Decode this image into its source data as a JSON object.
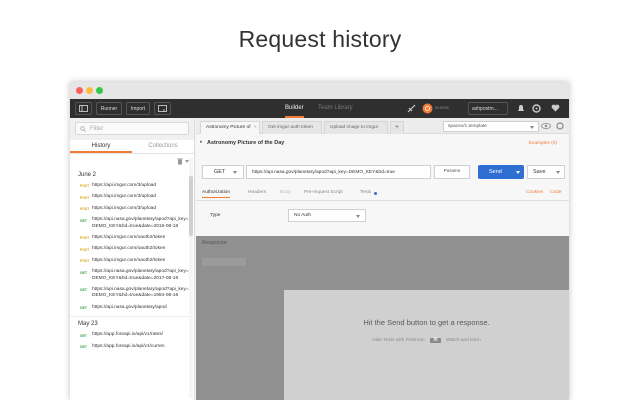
{
  "page": {
    "heading": "Request history"
  },
  "colors": {
    "accent": "#f27b35",
    "send_button": "#2f6fd4",
    "toolbar_bg": "#2f2f2f",
    "get_method": "#3a9e45",
    "post_method": "#d8a21e"
  },
  "toolbar": {
    "runner_label": "Runner",
    "import_label": "Import",
    "builder_tab": "Builder",
    "team_library_tab": "Team Library",
    "status_label": "IN SYNC",
    "workspace_label": "ashpostm...",
    "icons": [
      "sidebar-toggle-icon",
      "new-window-icon",
      "satellite-icon",
      "sync-icon",
      "bell-icon",
      "settings-icon",
      "heart-icon"
    ]
  },
  "sidebar": {
    "filter_placeholder": "Filter",
    "tabs": [
      "History",
      "Collections"
    ],
    "groups": [
      {
        "date": "June 2",
        "items": [
          {
            "method": "POST",
            "url": "https://api.imgur.com/3/upload"
          },
          {
            "method": "POST",
            "url": "https://api.imgur.com/3/upload"
          },
          {
            "method": "POST",
            "url": "https://api.imgur.com/3/upload"
          },
          {
            "method": "GET",
            "url": "https://api.nasa.gov/planetary/apod?api_key=DEMO_KEY&hd=true&date=2016-08-18"
          },
          {
            "method": "POST",
            "url": "https://api.imgur.com/oauth2/token"
          },
          {
            "method": "POST",
            "url": "https://api.imgur.com/oauth2/token"
          },
          {
            "method": "POST",
            "url": "https://api.imgur.com/oauth2/token"
          },
          {
            "method": "GET",
            "url": "https://api.nasa.gov/planetary/apod?api_key=DEMO_KEY&hd=true&date=2017-08-18"
          },
          {
            "method": "GET",
            "url": "https://api.nasa.gov/planetary/apod?api_key=DEMO_KEY&hd=true&date=1984-08-18"
          },
          {
            "method": "GET",
            "url": "https://api.nasa.gov/planetary/apod"
          }
        ]
      },
      {
        "date": "May 23",
        "items": [
          {
            "method": "GET",
            "url": "https://app.foreapi.io/api/v1/rates/"
          },
          {
            "method": "GET",
            "url": "https://app.foreapi.io/api/v1/curren"
          }
        ]
      }
    ]
  },
  "main": {
    "tabs": [
      {
        "label": "Astronomy Picture of"
      },
      {
        "label": "Get imgur auth token"
      },
      {
        "label": "Upload image to imgur"
      }
    ],
    "environment": "spacex/1.template",
    "request_name": "Astronomy Picture of the Day",
    "examples_label": "Examples (0)",
    "method": "GET",
    "url": "https://api.nasa.gov/planetary/apod?api_key=DEMO_KEY&hd=true",
    "params_label": "Params",
    "send_label": "Send",
    "save_label": "Save",
    "subtabs": [
      "Authorization",
      "Headers",
      "Body",
      "Pre-request Script",
      "Tests"
    ],
    "cookies_label": "Cookies",
    "code_label": "Code",
    "auth_type_label": "Type",
    "auth_type_value": "No Auth",
    "response_label": "Response",
    "empty_message": "Hit the Send button to get a response.",
    "shortcut_prefix": "Hide Tests with Postman",
    "shortcut_key": "⌘",
    "shortcut_suffix": "Watch and learn"
  }
}
